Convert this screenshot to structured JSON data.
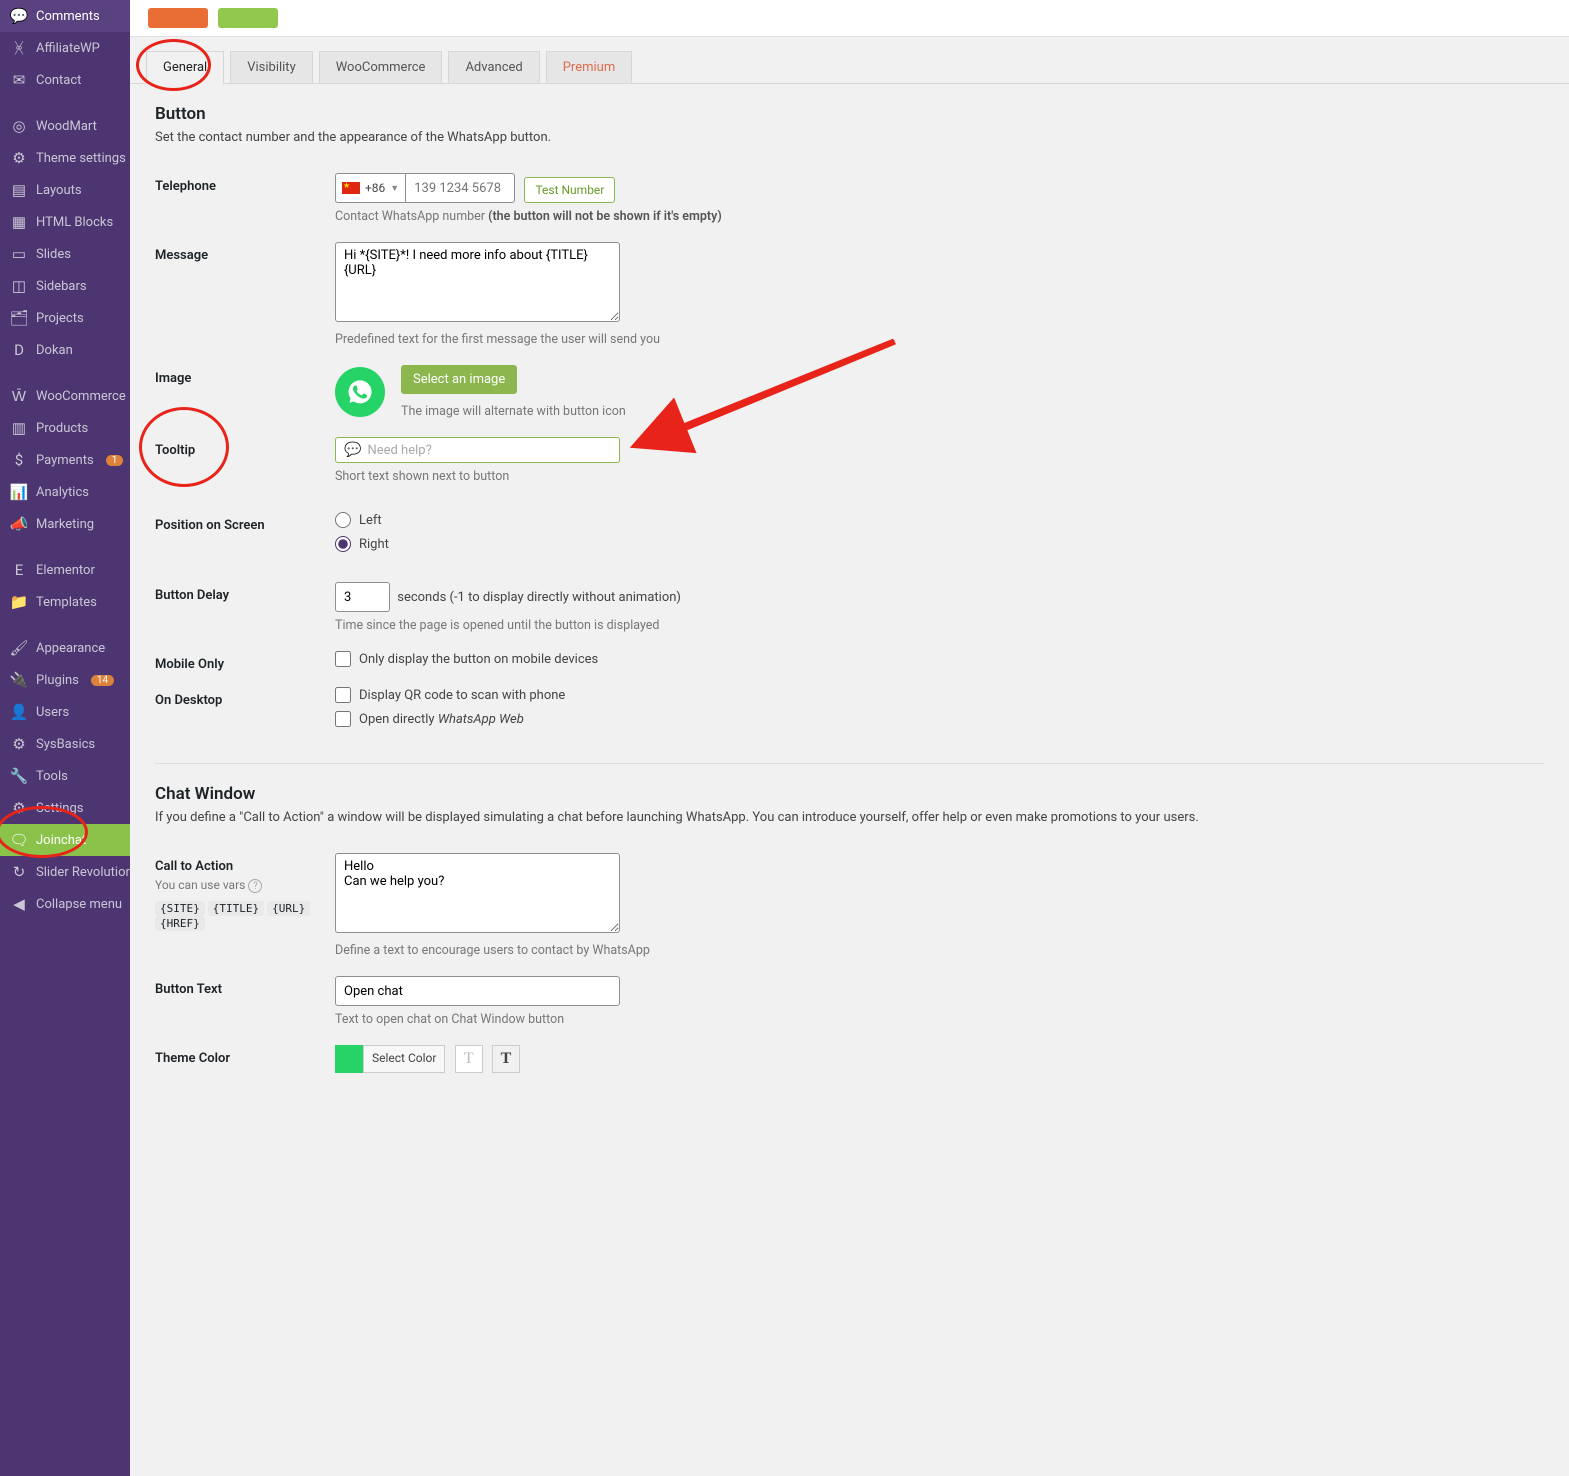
{
  "sidebar": {
    "items": [
      {
        "icon": "comments",
        "label": "Comments"
      },
      {
        "icon": "affiliate",
        "label": "AffiliateWP"
      },
      {
        "icon": "mail",
        "label": "Contact"
      },
      {
        "icon": "woodmart",
        "label": "WoodMart"
      },
      {
        "icon": "sliders",
        "label": "Theme settings"
      },
      {
        "icon": "layouts",
        "label": "Layouts"
      },
      {
        "icon": "html",
        "label": "HTML Blocks"
      },
      {
        "icon": "slides",
        "label": "Slides"
      },
      {
        "icon": "sidebars",
        "label": "Sidebars"
      },
      {
        "icon": "projects",
        "label": "Projects"
      },
      {
        "icon": "dokan",
        "label": "Dokan"
      },
      {
        "icon": "woo",
        "label": "WooCommerce"
      },
      {
        "icon": "products",
        "label": "Products"
      },
      {
        "icon": "payments",
        "label": "Payments",
        "badge": "1"
      },
      {
        "icon": "analytics",
        "label": "Analytics"
      },
      {
        "icon": "marketing",
        "label": "Marketing"
      },
      {
        "icon": "elementor",
        "label": "Elementor"
      },
      {
        "icon": "templates",
        "label": "Templates"
      },
      {
        "icon": "appearance",
        "label": "Appearance"
      },
      {
        "icon": "plugins",
        "label": "Plugins",
        "badge": "14"
      },
      {
        "icon": "users",
        "label": "Users"
      },
      {
        "icon": "sysbasics",
        "label": "SysBasics"
      },
      {
        "icon": "tools",
        "label": "Tools"
      },
      {
        "icon": "settings",
        "label": "Settings"
      },
      {
        "icon": "joinchat",
        "label": "Joinchat",
        "active": true
      },
      {
        "icon": "slider",
        "label": "Slider Revolution"
      },
      {
        "icon": "collapse",
        "label": "Collapse menu"
      }
    ]
  },
  "tabs": {
    "general": "General",
    "visibility": "Visibility",
    "woocommerce": "WooCommerce",
    "advanced": "Advanced",
    "premium": "Premium"
  },
  "button_section": {
    "title": "Button",
    "desc": "Set the contact number and the appearance of the WhatsApp button."
  },
  "fields": {
    "telephone": {
      "label": "Telephone",
      "country_code": "+86",
      "placeholder": "139 1234 5678",
      "test_btn": "Test Number",
      "help_pre": "Contact WhatsApp number ",
      "help_bold": "(the button will not be shown if it's empty)"
    },
    "message": {
      "label": "Message",
      "value": "Hi *{SITE}*! I need more info about {TITLE} {URL}",
      "help": "Predefined text for the first message the user will send you"
    },
    "image": {
      "label": "Image",
      "btn": "Select an image",
      "help": "The image will alternate with button icon"
    },
    "tooltip": {
      "label": "Tooltip",
      "placeholder": "Need help?",
      "help": "Short text shown next to button"
    },
    "position": {
      "label": "Position on Screen",
      "left": "Left",
      "right": "Right"
    },
    "delay": {
      "label": "Button Delay",
      "value": "3",
      "suffix": "seconds (-1 to display directly without animation)",
      "help": "Time since the page is opened until the button is displayed"
    },
    "mobile": {
      "label": "Mobile Only",
      "check": "Only display the button on mobile devices"
    },
    "desktop": {
      "label": "On Desktop",
      "qr": "Display QR code to scan with phone",
      "direct_pre": "Open directly ",
      "direct_em": "WhatsApp Web"
    }
  },
  "chat_section": {
    "title": "Chat Window",
    "desc": "If you define a \"Call to Action\" a window will be displayed simulating a chat before launching WhatsApp. You can introduce yourself, offer help or even make promotions to your users."
  },
  "chat_fields": {
    "cta": {
      "label": "Call to Action",
      "vars_label": "You can use vars",
      "vars": [
        "{SITE}",
        "{TITLE}",
        "{URL}",
        "{HREF}"
      ],
      "value": "Hello\nCan we help you?",
      "help": "Define a text to encourage users to contact by WhatsApp"
    },
    "button_text": {
      "label": "Button Text",
      "value": "Open chat",
      "help": "Text to open chat on Chat Window button"
    },
    "theme_color": {
      "label": "Theme Color",
      "btn": "Select Color"
    }
  }
}
